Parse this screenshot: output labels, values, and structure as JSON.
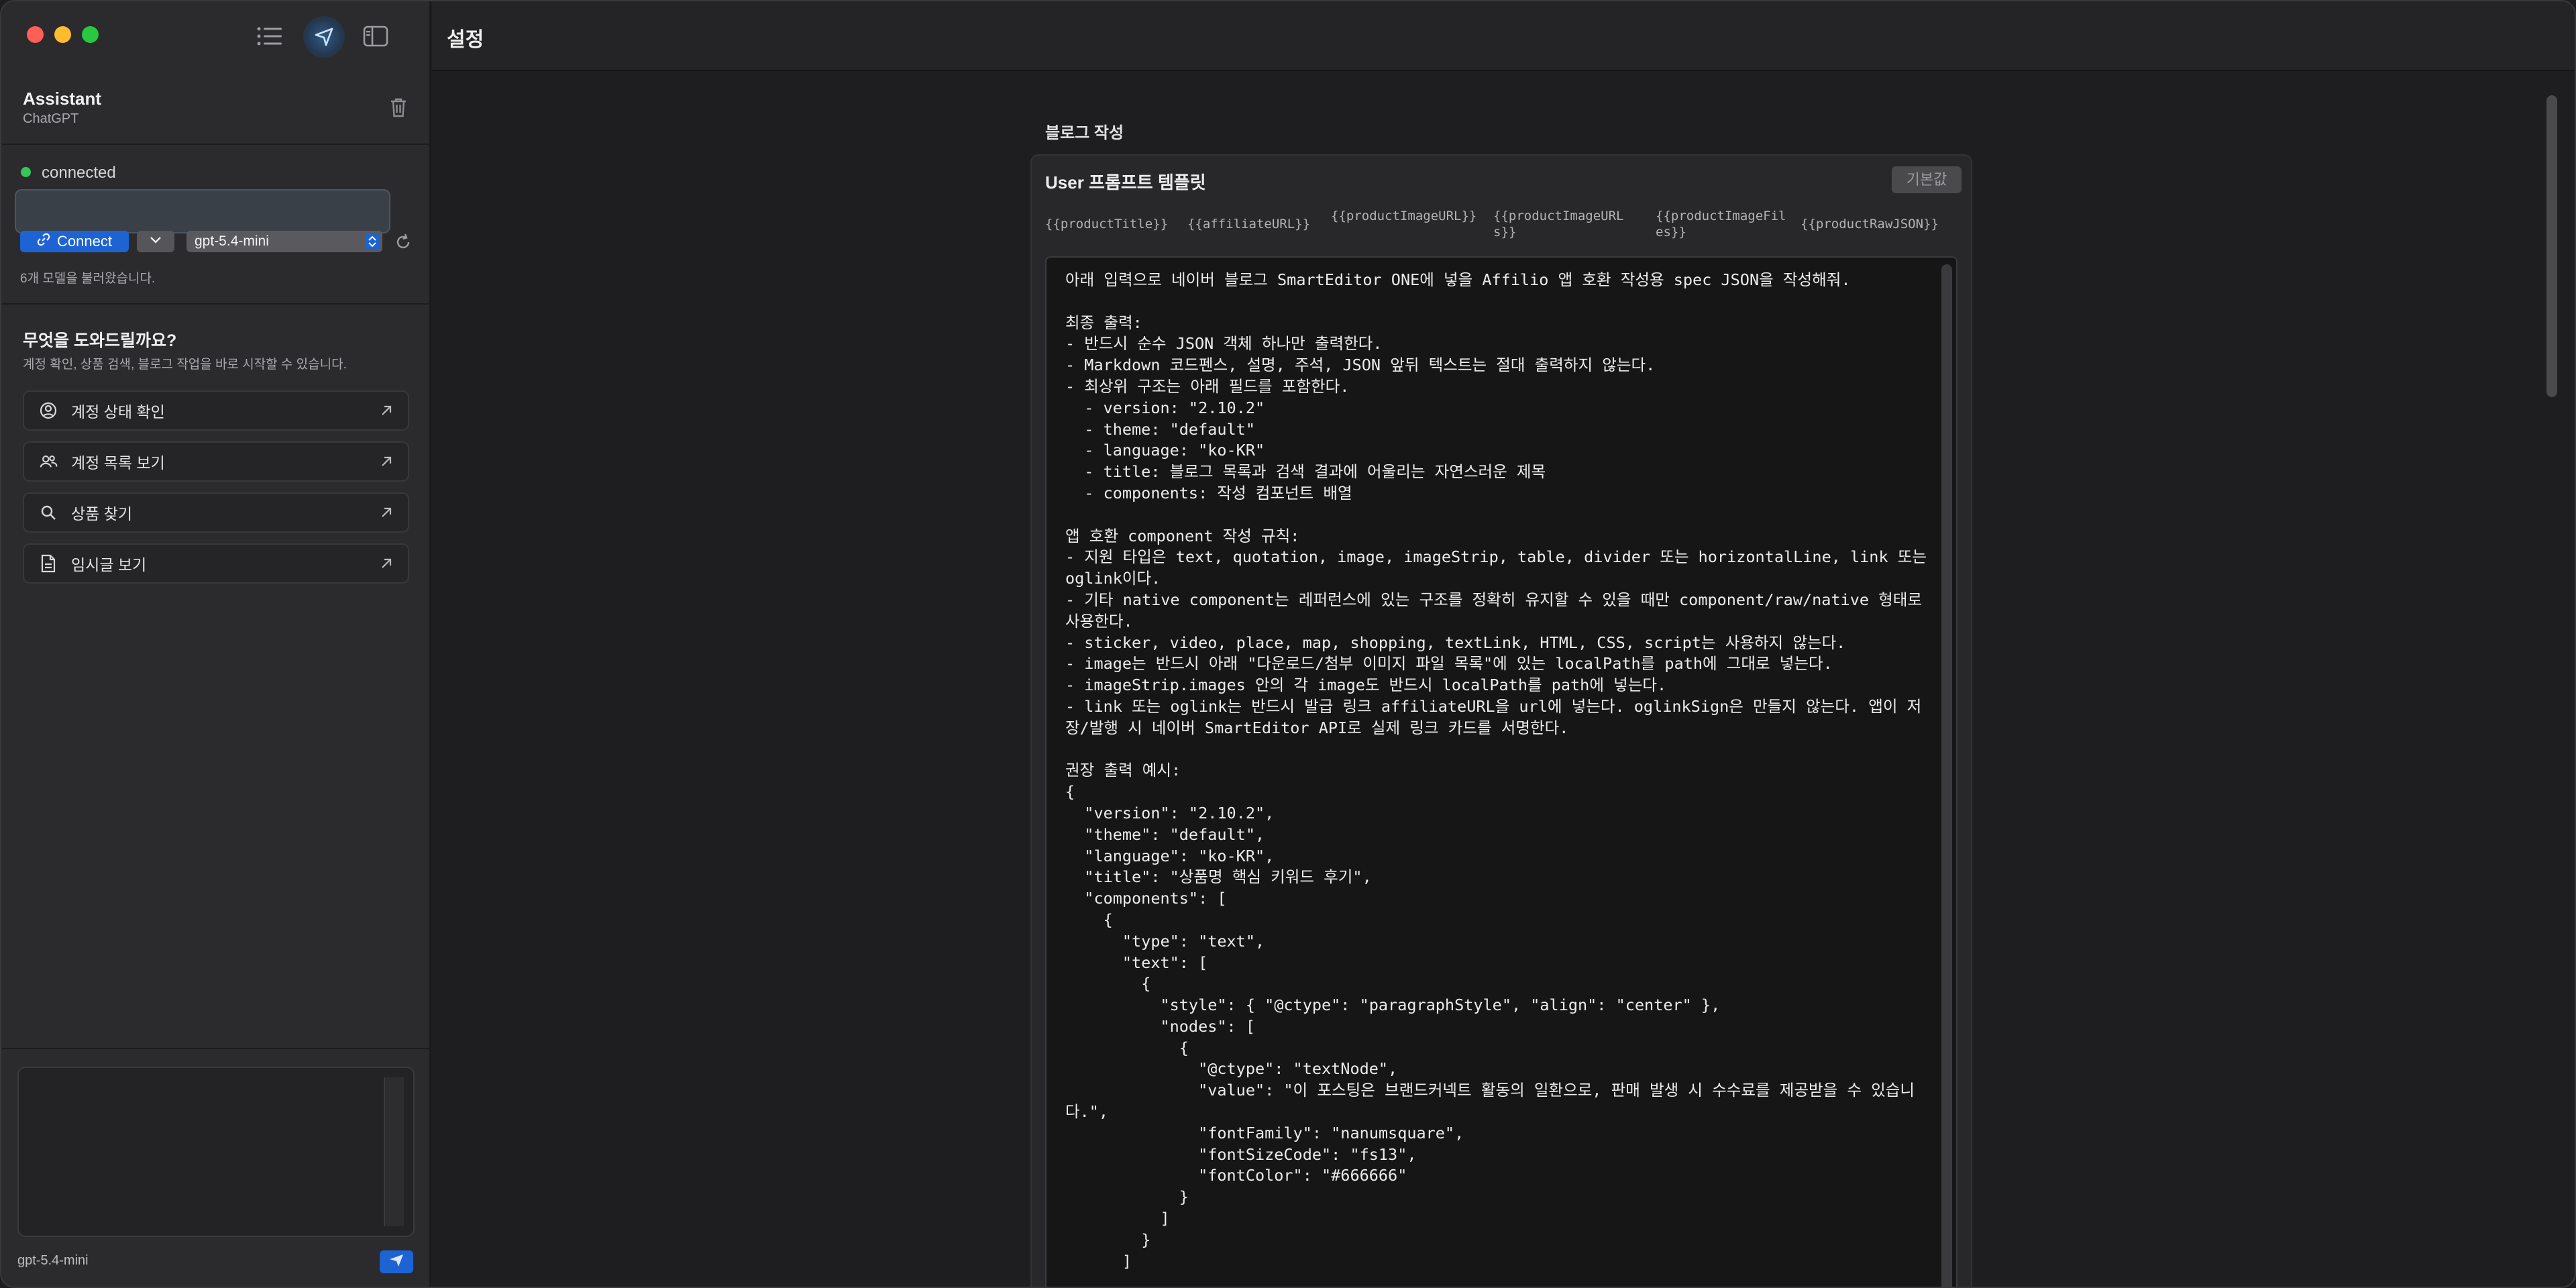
{
  "sidebar": {
    "assistant": {
      "title": "Assistant",
      "subtitle": "ChatGPT"
    },
    "connection": {
      "status": "connected",
      "api_key_value": "",
      "connect_label": "Connect",
      "model_selected": "gpt-5.4-mini",
      "models_loaded": "6개 모델을 불러왔습니다."
    },
    "help": {
      "title": "무엇을 도와드릴까요?",
      "subtitle": "계정 확인, 상품 검색, 블로그 작업을 바로 시작할 수 있습니다."
    },
    "actions": [
      {
        "label": "계정 상태 확인",
        "icon": "account-status-icon"
      },
      {
        "label": "계정 목록 보기",
        "icon": "users-icon"
      },
      {
        "label": "상품 찾기",
        "icon": "search-icon"
      },
      {
        "label": "임시글 보기",
        "icon": "document-icon"
      }
    ],
    "composer": {
      "value": "",
      "model": "gpt-5.4-mini"
    }
  },
  "main": {
    "title": "설정",
    "section_label": "블로그 작성",
    "card": {
      "title": "User 프롬프트 템플릿",
      "default_label": "기본값",
      "variables": [
        "{{productTitle}}",
        "{{affiliateURL}}",
        "{{productImageURL}}",
        "{{productImageURLs}}",
        "{{productImageFiles}}",
        "{{productRawJSON}}"
      ],
      "template_text": "아래 입력으로 네이버 블로그 SmartEditor ONE에 넣을 Affilio 앱 호환 작성용 spec JSON을 작성해줘.\n\n최종 출력:\n- 반드시 순수 JSON 객체 하나만 출력한다.\n- Markdown 코드펜스, 설명, 주석, JSON 앞뒤 텍스트는 절대 출력하지 않는다.\n- 최상위 구조는 아래 필드를 포함한다.\n  - version: \"2.10.2\"\n  - theme: \"default\"\n  - language: \"ko-KR\"\n  - title: 블로그 목록과 검색 결과에 어울리는 자연스러운 제목\n  - components: 작성 컴포넌트 배열\n\n앱 호환 component 작성 규칙:\n- 지원 타입은 text, quotation, image, imageStrip, table, divider 또는 horizontalLine, link 또는 oglink이다.\n- 기타 native component는 레퍼런스에 있는 구조를 정확히 유지할 수 있을 때만 component/raw/native 형태로 사용한다.\n- sticker, video, place, map, shopping, textLink, HTML, CSS, script는 사용하지 않는다.\n- image는 반드시 아래 \"다운로드/첨부 이미지 파일 목록\"에 있는 localPath를 path에 그대로 넣는다.\n- imageStrip.images 안의 각 image도 반드시 localPath를 path에 넣는다.\n- link 또는 oglink는 반드시 발급 링크 affiliateURL을 url에 넣는다. oglinkSign은 만들지 않는다. 앱이 저장/발행 시 네이버 SmartEditor API로 실제 링크 카드를 서명한다.\n\n권장 출력 예시:\n{\n  \"version\": \"2.10.2\",\n  \"theme\": \"default\",\n  \"language\": \"ko-KR\",\n  \"title\": \"상품명 핵심 키워드 후기\",\n  \"components\": [\n    {\n      \"type\": \"text\",\n      \"text\": [\n        {\n          \"style\": { \"@ctype\": \"paragraphStyle\", \"align\": \"center\" },\n          \"nodes\": [\n            {\n              \"@ctype\": \"textNode\",\n              \"value\": \"이 포스팅은 브랜드커넥트 활동의 일환으로, 판매 발생 시 수수료를 제공받을 수 있습니다.\",\n              \"fontFamily\": \"nanumsquare\",\n              \"fontSizeCode\": \"fs13\",\n              \"fontColor\": \"#666666\"\n            }\n          ]\n        }\n      ]"
    }
  },
  "colors": {
    "accent": "#1d63d4",
    "status_connected": "#33c758",
    "traffic_red": "#fe5f57",
    "traffic_yellow": "#febc2e",
    "traffic_green": "#28c840"
  }
}
